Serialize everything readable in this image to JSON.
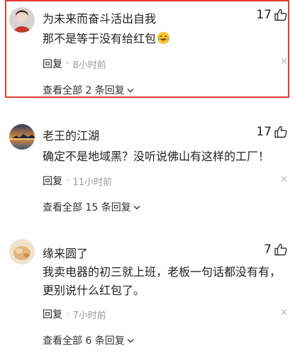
{
  "comments": [
    {
      "username": "为未来而奋斗活出自我",
      "likes": "17",
      "content": "那不是等于没有给红包",
      "emoji": "crying-laughing-emoji",
      "reply_label": "回复",
      "time": "8小时前",
      "view_all": "查看全部 2 条回复",
      "highlighted": true
    },
    {
      "username": "老王的江湖",
      "likes": "17",
      "content": "确定不是地域黑？没听说佛山有这样的工厂！",
      "reply_label": "回复",
      "time": "11小时前",
      "view_all": "查看全部 15 条回复"
    },
    {
      "username": "缘来圆了",
      "likes": "7",
      "content": "我卖电器的初三就上班，老板一句话都没有有，更别说什么红包了。",
      "reply_label": "回复",
      "time": "7小时前",
      "view_all": "查看全部 6 条回复"
    }
  ],
  "colors": {
    "highlight_border": "#e23b2e",
    "muted": "#999999",
    "text": "#222222"
  },
  "icons": {
    "like": "thumbs-up-icon",
    "close": "close-icon",
    "expand": "chevron-down-icon"
  },
  "separator": "·",
  "close_glyph": "✕"
}
